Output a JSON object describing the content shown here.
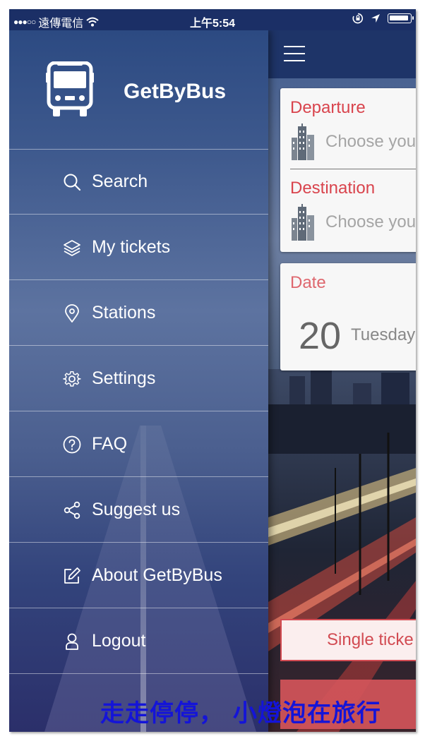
{
  "status_bar": {
    "signal_dots": "●●●○○",
    "carrier": "遠傳電信",
    "time": "上午5:54",
    "wifi_icon": "wifi-icon",
    "lock_rotation_icon": "orientation-lock-icon",
    "location_icon": "location-arrow-icon",
    "battery_icon": "battery-icon"
  },
  "drawer": {
    "brand": "GetByBus",
    "logo_icon": "bus-icon",
    "items": [
      {
        "label": "Search",
        "icon": "search-icon"
      },
      {
        "label": "My tickets",
        "icon": "layers-icon"
      },
      {
        "label": "Stations",
        "icon": "map-pin-icon"
      },
      {
        "label": "Settings",
        "icon": "gear-icon"
      },
      {
        "label": "FAQ",
        "icon": "help-circle-icon"
      },
      {
        "label": "Suggest us",
        "icon": "share-icon"
      },
      {
        "label": "About GetByBus",
        "icon": "edit-icon"
      },
      {
        "label": "Logout",
        "icon": "user-icon"
      }
    ]
  },
  "main": {
    "menu_icon": "hamburger-icon",
    "departure_label": "Departure",
    "departure_placeholder": "Choose you",
    "destination_label": "Destination",
    "destination_placeholder": "Choose you",
    "city_icon": "city-buildings-icon",
    "date_label": "Date",
    "date_day_number": "20",
    "date_weekday": "Tuesday",
    "single_ticket_label": "Single ticke"
  },
  "watermark": "走走停停， 小燈泡在旅行",
  "colors": {
    "accent_red": "#d9444d",
    "nav_bar": "#1e3468",
    "watermark": "#1414d8"
  }
}
